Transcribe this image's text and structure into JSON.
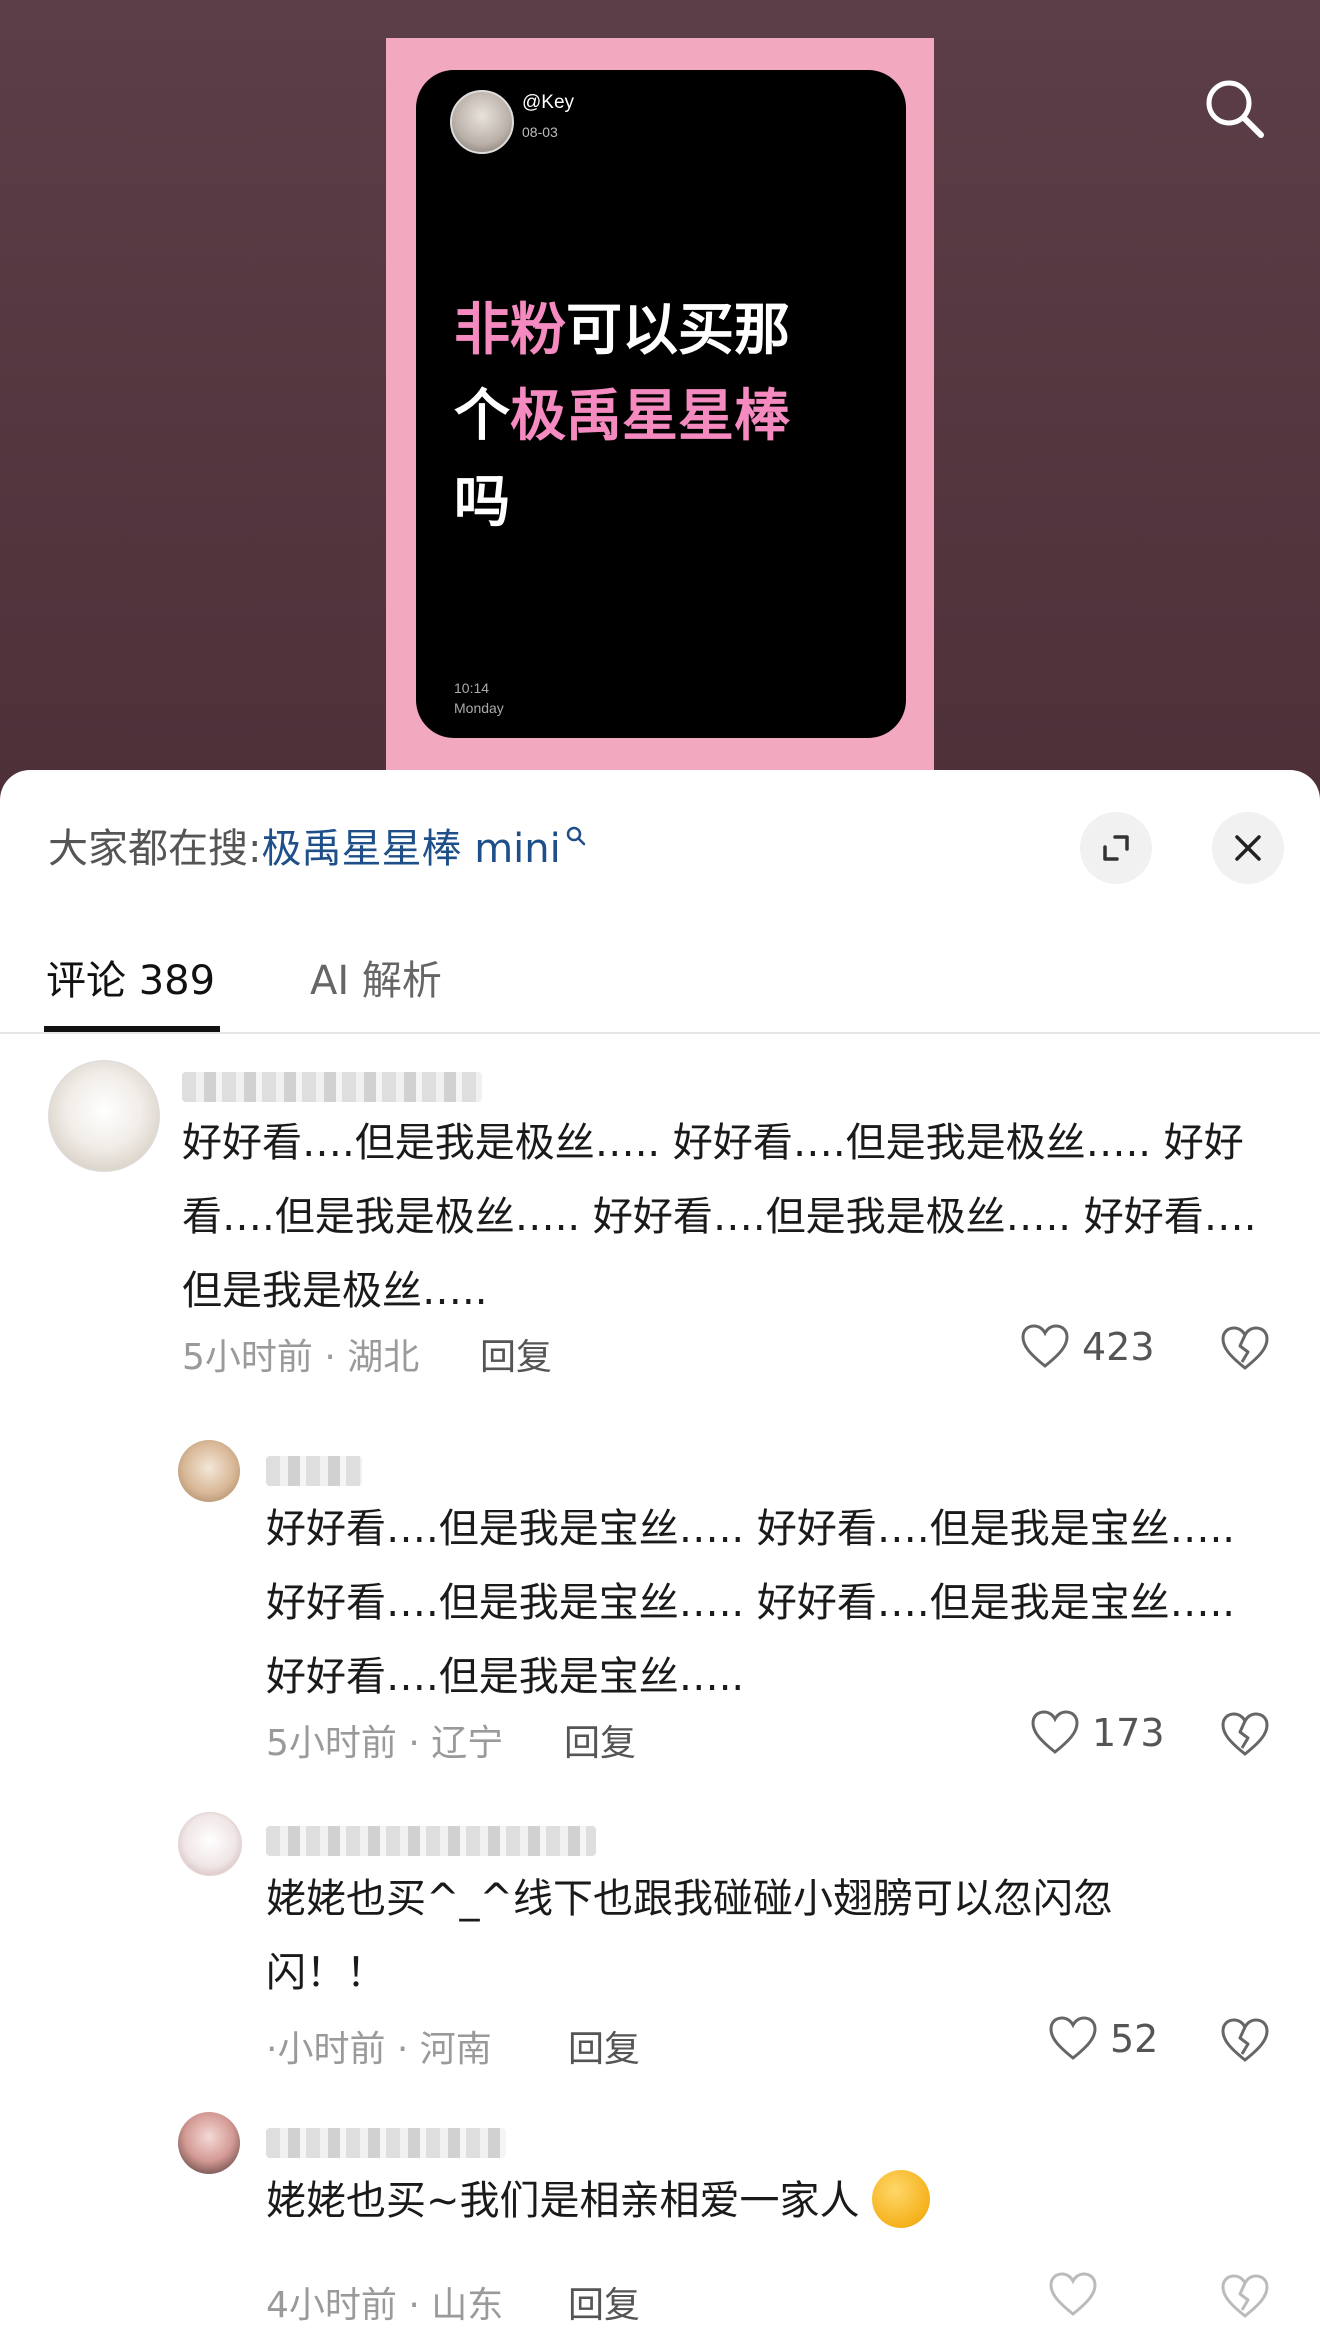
{
  "post": {
    "handle": "@Key",
    "date": "08-03",
    "text_line1_pink": "非粉",
    "text_line1_white": "可以买那",
    "text_line2_white": "个",
    "text_line2_pink": "极禹星星棒",
    "text_line3": "吗",
    "time": "10:14",
    "day": "Monday"
  },
  "header": {
    "trending_prefix": "大家都在搜:",
    "trending_link": "极禹星星棒 mini"
  },
  "tabs": [
    {
      "label": "评论 389"
    },
    {
      "label": "AI 解析"
    }
  ],
  "reply_label": "回复",
  "comments": [
    {
      "text": "好好看….但是我是极丝….. 好好看….但是我是极丝….. 好好看….但是我是极丝….. 好好看….但是我是极丝….. 好好看….但是我是极丝…..",
      "meta": "5小时前 · 湖北",
      "likes": "423"
    },
    {
      "text": "好好看….但是我是宝丝….. 好好看….但是我是宝丝….. 好好看….但是我是宝丝….. 好好看….但是我是宝丝….. 好好看….但是我是宝丝…..",
      "meta": "5小时前 · 辽宁",
      "likes": "173"
    },
    {
      "text": "姥姥也买^_^线下也跟我碰碰小翅膀可以忽闪忽闪！！",
      "meta": "·小时前 · 河南",
      "likes": "52"
    },
    {
      "text": "姥姥也买~我们是相亲相爱一家人",
      "meta": "4小时前 · 山东",
      "likes": ""
    }
  ]
}
